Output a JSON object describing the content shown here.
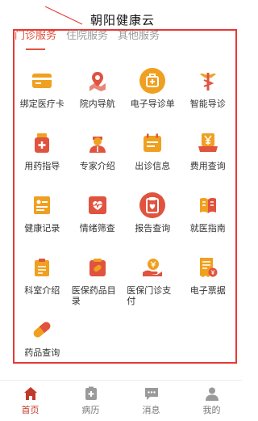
{
  "app_title": "朝阳健康云",
  "tabs": [
    {
      "label": "门诊服务",
      "active": true
    },
    {
      "label": "住院服务",
      "active": false
    },
    {
      "label": "其他服务",
      "active": false
    }
  ],
  "grid_items": [
    {
      "label": "绑定医疗卡",
      "icon": "card-icon",
      "color": "#f0a020"
    },
    {
      "label": "院内导航",
      "icon": "map-pin-icon",
      "color": "#e0533f"
    },
    {
      "label": "电子导诊单",
      "icon": "medical-bag-icon",
      "color": "#f0a020"
    },
    {
      "label": "智能导诊",
      "icon": "caduceus-icon",
      "color": "#e0533f"
    },
    {
      "label": "用药指导",
      "icon": "medicine-bottle-icon",
      "color": "#e0533f"
    },
    {
      "label": "专家介绍",
      "icon": "doctor-icon",
      "color": "#e0533f"
    },
    {
      "label": "出诊信息",
      "icon": "calendar-icon",
      "color": "#f0a020"
    },
    {
      "label": "费用查询",
      "icon": "yen-tray-icon",
      "color": "#f0a020"
    },
    {
      "label": "健康记录",
      "icon": "notebook-icon",
      "color": "#f0a020"
    },
    {
      "label": "情绪筛查",
      "icon": "heart-monitor-icon",
      "color": "#e0533f"
    },
    {
      "label": "报告查询",
      "icon": "report-icon",
      "color": "#e0533f"
    },
    {
      "label": "就医指南",
      "icon": "book-icon",
      "color": "#f0a020"
    },
    {
      "label": "科室介绍",
      "icon": "clipboard-icon",
      "color": "#f0a020"
    },
    {
      "label": "医保药品目录",
      "icon": "pill-box-icon",
      "color": "#e0533f"
    },
    {
      "label": "医保门诊支付",
      "icon": "hand-coin-icon",
      "color": "#e0533f"
    },
    {
      "label": "电子票据",
      "icon": "receipt-icon",
      "color": "#f0a020"
    },
    {
      "label": "药品查询",
      "icon": "capsule-icon",
      "color": "#f0a020"
    }
  ],
  "tabbar": [
    {
      "label": "首页",
      "icon": "home-icon",
      "active": true
    },
    {
      "label": "病历",
      "icon": "medical-record-icon",
      "active": false
    },
    {
      "label": "消息",
      "icon": "message-icon",
      "active": false
    },
    {
      "label": "我的",
      "icon": "user-icon",
      "active": false
    }
  ]
}
